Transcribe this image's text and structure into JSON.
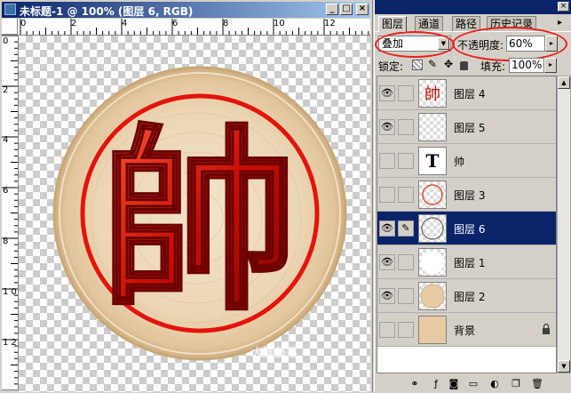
{
  "document": {
    "title": "未标题-1 @ 100% (图层 6, RGB)",
    "h_ruler": [
      "0",
      "2",
      "4",
      "6",
      "8",
      "10",
      "12"
    ],
    "v_ruler": [
      "0",
      "2",
      "4",
      "6",
      "8",
      "1 0",
      "1 2"
    ],
    "artwork_char": "帥",
    "watermark": "大脚部落"
  },
  "palette": {
    "tabs": [
      {
        "label": "图层",
        "active": true
      },
      {
        "label": "通道",
        "active": false
      },
      {
        "label": "路径",
        "active": false
      },
      {
        "label": "历史记录",
        "active": false
      }
    ],
    "blend_mode": "叠加",
    "opacity_label": "不透明度:",
    "opacity_value": "60%",
    "lock_label": "锁定:",
    "fill_label": "填充:",
    "fill_value": "100%",
    "layers": [
      {
        "name": "图层 4",
        "visible": true,
        "selected": false,
        "thumb": "char-red"
      },
      {
        "name": "图层 5",
        "visible": true,
        "selected": false,
        "thumb": "transparent"
      },
      {
        "name": "帅",
        "visible": false,
        "selected": false,
        "thumb": "text"
      },
      {
        "name": "图层 3",
        "visible": false,
        "selected": false,
        "thumb": "ring-red"
      },
      {
        "name": "图层 6",
        "visible": true,
        "selected": true,
        "thumb": "ring-outline"
      },
      {
        "name": "图层 1",
        "visible": true,
        "selected": false,
        "thumb": "white-disc"
      },
      {
        "name": "图层 2",
        "visible": true,
        "selected": false,
        "thumb": "wood-disc"
      },
      {
        "name": "背景",
        "visible": false,
        "selected": false,
        "thumb": "wood-fill",
        "locked": true
      }
    ],
    "text_thumb_glyph": "T",
    "colors": {
      "highlight": "#0a246a",
      "annotation": "#e8201c",
      "wood": "#e6cba4",
      "red_char": "#d41a10"
    }
  }
}
